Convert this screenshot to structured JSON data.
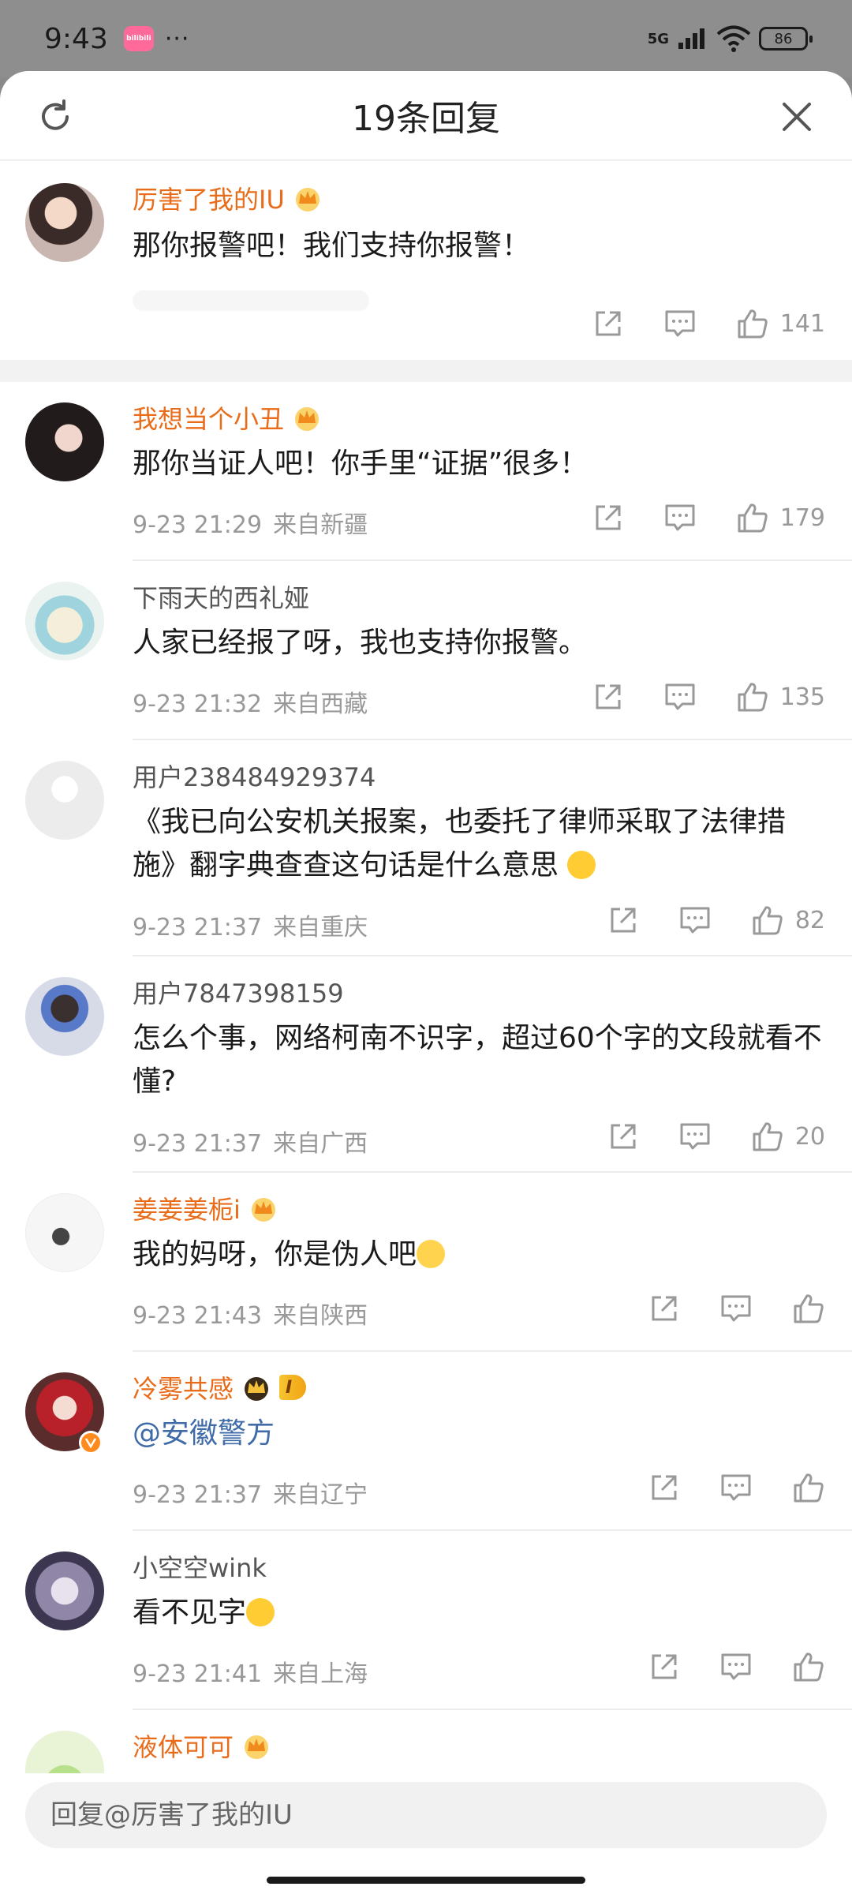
{
  "status_bar": {
    "time": "9:43",
    "app_badge": "bilibili",
    "dots": "···",
    "network": "5G",
    "battery": "86"
  },
  "header": {
    "title": "19条回复"
  },
  "top_comment": {
    "username": "厉害了我的IU",
    "text": "那你报警吧！我们支持你报警！",
    "likes": "141"
  },
  "replies": [
    {
      "username": "我想当个小丑",
      "vip": true,
      "text": "那你当证人吧！你手里“证据”很多！",
      "date": "9-23 21:29",
      "location": "来自新疆",
      "likes": "179"
    },
    {
      "username": "下雨天的西礼娅",
      "vip": false,
      "text": "人家已经报了呀，我也支持你报警。",
      "date": "9-23 21:32",
      "location": "来自西藏",
      "likes": "135"
    },
    {
      "username": "用户238484929374",
      "vip": false,
      "text": "《我已向公安机关报案，也委托了律师采取了法律措施》翻字典查查这句话是什么意思",
      "date": "9-23 21:37",
      "location": "来自重庆",
      "likes": "82"
    },
    {
      "username": "用户7847398159",
      "vip": false,
      "text": "怎么个事，网络柯南不识字，超过60个字的文段就看不懂?",
      "date": "9-23 21:37",
      "location": "来自广西",
      "likes": "20"
    },
    {
      "username": "姜姜姜栀i",
      "vip": true,
      "text": "我的妈呀，你是伪人吧",
      "date": "9-23 21:43",
      "location": "来自陕西",
      "likes": ""
    },
    {
      "username": "冷雾共感",
      "vip": true,
      "level_tag": "I",
      "text": "@安徽警方",
      "date": "9-23 21:37",
      "location": "来自辽宁",
      "likes": ""
    },
    {
      "username": "小空空wink",
      "vip": false,
      "text": "看不见字",
      "date": "9-23 21:41",
      "location": "来自上海",
      "likes": ""
    },
    {
      "username": "液体可可",
      "vip": true
    }
  ],
  "reply_input": {
    "placeholder": "回复@厉害了我的IU"
  },
  "colors": {
    "vip_name": "#e86c1a",
    "mention": "#3f6ba8",
    "meta": "#999999"
  }
}
